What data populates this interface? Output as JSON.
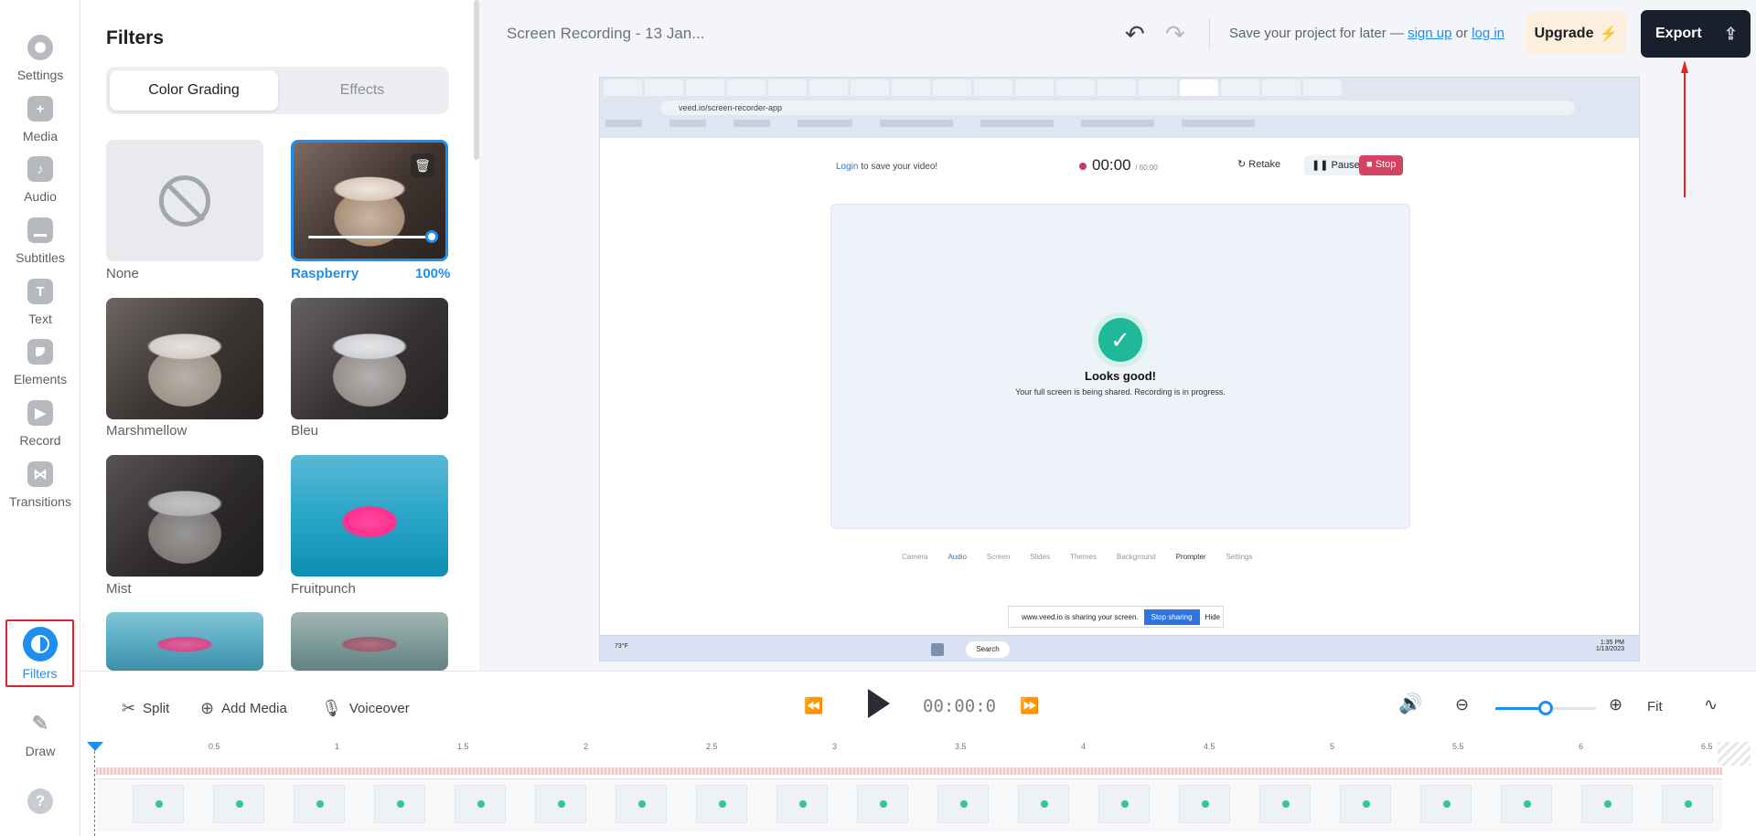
{
  "rail": {
    "items": [
      {
        "label": "Settings",
        "icon": "gear-icon"
      },
      {
        "label": "Media",
        "icon": "plus-icon"
      },
      {
        "label": "Audio",
        "icon": "music-note-icon"
      },
      {
        "label": "Subtitles",
        "icon": "subtitles-icon"
      },
      {
        "label": "Text",
        "icon": "text-t-icon"
      },
      {
        "label": "Elements",
        "icon": "elements-icon"
      },
      {
        "label": "Record",
        "icon": "camera-icon"
      },
      {
        "label": "Transitions",
        "icon": "transitions-icon"
      },
      {
        "label": "Filters",
        "icon": "half-circle-icon",
        "active": true
      },
      {
        "label": "Draw",
        "icon": "pencil-icon"
      }
    ],
    "help": "?"
  },
  "panel": {
    "title": "Filters",
    "tabs": [
      {
        "label": "Color Grading",
        "active": true
      },
      {
        "label": "Effects",
        "active": false
      }
    ],
    "filters": [
      {
        "name": "None"
      },
      {
        "name": "Raspberry",
        "selected": true,
        "strength": "100%"
      },
      {
        "name": "Marshmellow"
      },
      {
        "name": "Bleu"
      },
      {
        "name": "Mist"
      },
      {
        "name": "Fruitpunch"
      }
    ]
  },
  "header": {
    "project_title": "Screen Recording - 13 Jan...",
    "save_prefix": "Save your project for later — ",
    "sign_up": "sign up",
    "or": " or ",
    "log_in": "log in",
    "upgrade": "Upgrade",
    "export": "Export"
  },
  "preview": {
    "url": "veed.io/screen-recorder-app",
    "login_link": "Login",
    "login_rest": " to save your video!",
    "timer": "00:00",
    "timer_max": "/ 60:00",
    "retake": "Retake",
    "pause": "Pause",
    "stop": "Stop",
    "status_title": "Looks good!",
    "status_sub": "Your full screen is being shared. Recording is in progress.",
    "tools": [
      "Camera",
      "Audio",
      "Screen",
      "Slides",
      "Themes",
      "Background",
      "Prompter",
      "Settings"
    ],
    "sharing_text": "www.veed.io is sharing your screen.",
    "stop_sharing": "Stop sharing",
    "hide": "Hide",
    "task_search": "Search",
    "task_time": "1:35 PM",
    "task_date": "1/13/2023",
    "weather": "73°F"
  },
  "controls": {
    "split": "Split",
    "add_media": "Add Media",
    "voiceover": "Voiceover",
    "timecode": "00:00:0",
    "fit": "Fit",
    "zoom_level": 0.5
  },
  "timeline": {
    "ticks": [
      "0.5",
      "1",
      "1.5",
      "2",
      "2.5",
      "3",
      "3.5",
      "4",
      "4.5",
      "5",
      "5.5",
      "6",
      "6.5"
    ]
  },
  "colors": {
    "accent": "#1f8ef1",
    "export_bg": "#1a1f2e",
    "upgrade_bg": "#fdeedd",
    "highlight_red": "#e8202a"
  }
}
